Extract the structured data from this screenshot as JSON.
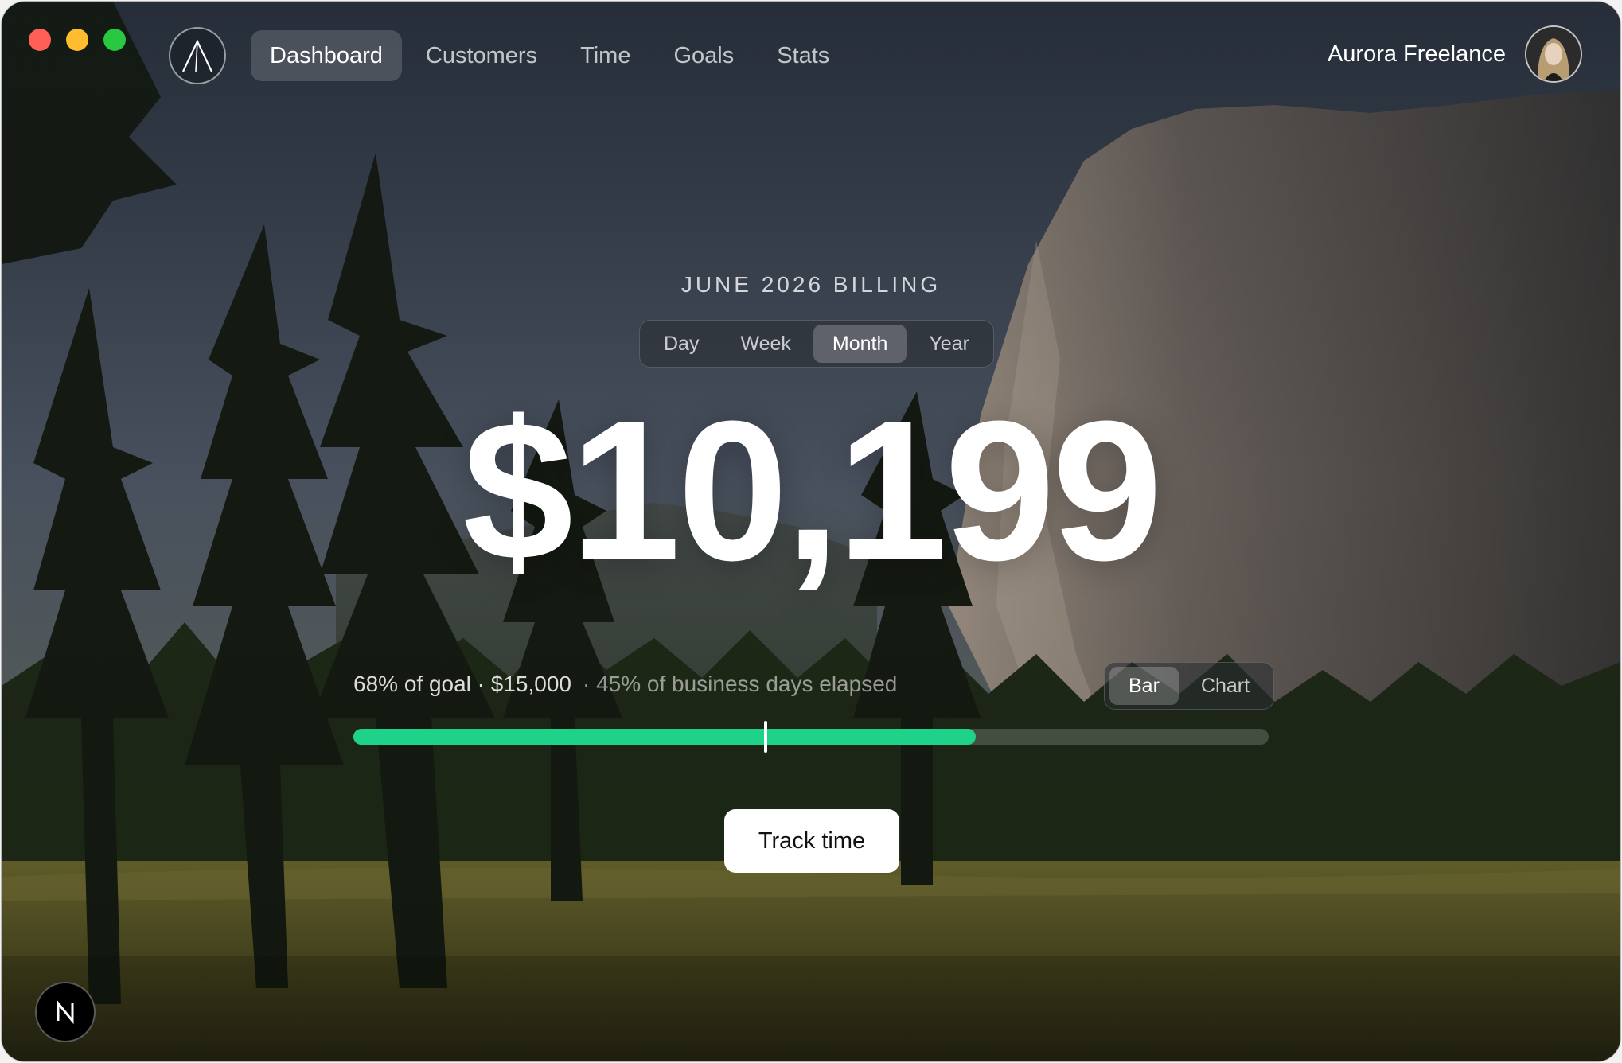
{
  "nav": {
    "items": [
      {
        "label": "Dashboard",
        "active": true
      },
      {
        "label": "Customers",
        "active": false
      },
      {
        "label": "Time",
        "active": false
      },
      {
        "label": "Goals",
        "active": false
      },
      {
        "label": "Stats",
        "active": false
      }
    ]
  },
  "account": {
    "name": "Aurora Freelance"
  },
  "billing": {
    "title": "JUNE 2026 BILLING",
    "periods": [
      {
        "label": "Day",
        "active": false
      },
      {
        "label": "Week",
        "active": false
      },
      {
        "label": "Month",
        "active": true
      },
      {
        "label": "Year",
        "active": false
      }
    ],
    "amount": "$10,199",
    "goal_text": "68% of goal · $15,000",
    "days_text": "· 45% of business days elapsed",
    "goal_progress_percent": 68,
    "days_elapsed_percent": 45,
    "view_options": [
      {
        "label": "Bar",
        "active": true
      },
      {
        "label": "Chart",
        "active": false
      }
    ],
    "track_button": "Track time"
  },
  "colors": {
    "progress_fill": "#1fd28a",
    "traffic_red": "#ff5f57",
    "traffic_yellow": "#febc2e",
    "traffic_green": "#28c840"
  },
  "icons": {
    "logo": "mountain-peak-logo",
    "badge": "n-logo"
  }
}
